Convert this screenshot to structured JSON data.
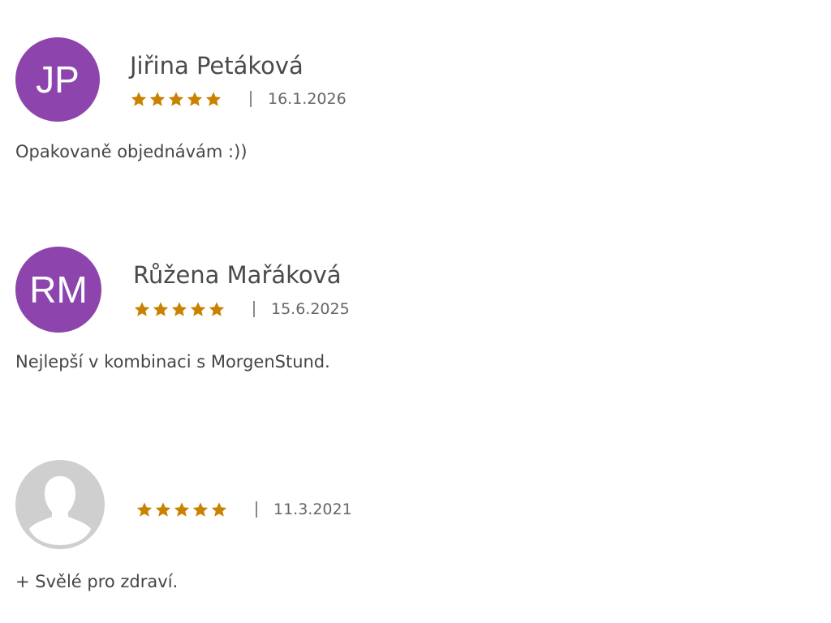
{
  "colors": {
    "avatar_purple": "#8e44ad",
    "avatar_placeholder": "#cfcfcf",
    "star": "#c98200"
  },
  "reviews": [
    {
      "initials": "JP",
      "name": "Jiřina Petáková",
      "rating": 5,
      "rating_max": 5,
      "date": "16.1.2026",
      "text": "Opakovaně objednávám :))"
    },
    {
      "initials": "RM",
      "name": "Růžena Mařáková",
      "rating": 5,
      "rating_max": 5,
      "date": "15.6.2025",
      "text": "Nejlepší v kombinaci s MorgenStund."
    },
    {
      "avatar_icon": "user-silhouette-icon",
      "rating": 5,
      "rating_max": 5,
      "date": "11.3.2021",
      "text": "+ Svělé pro zdraví."
    }
  ]
}
